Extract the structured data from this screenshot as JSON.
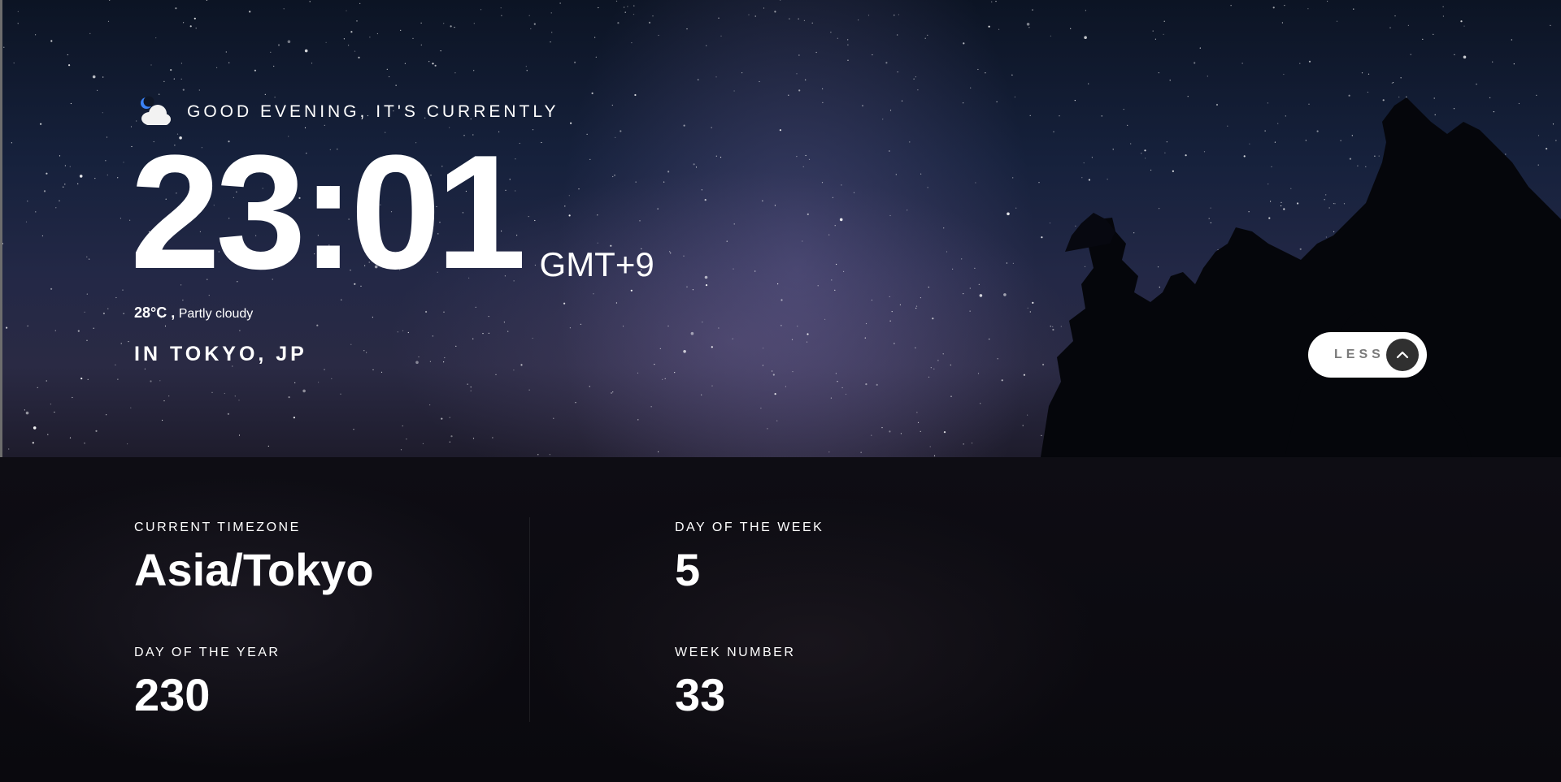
{
  "hero": {
    "greeting": "GOOD EVENING, IT'S CURRENTLY",
    "weather_icon": "moon-cloud-icon",
    "time": "23:01",
    "timezone_abbr": "GMT+9",
    "temperature": "28°C ,",
    "condition": "Partly cloudy",
    "location": "IN TOKYO, JP"
  },
  "toggle": {
    "label": "LESS",
    "icon": "chevron-up-icon"
  },
  "details": {
    "current_timezone": {
      "label": "CURRENT TIMEZONE",
      "value": "Asia/Tokyo"
    },
    "day_of_week": {
      "label": "DAY OF THE WEEK",
      "value": "5"
    },
    "day_of_year": {
      "label": "DAY OF THE YEAR",
      "value": "230"
    },
    "week_number": {
      "label": "WEEK NUMBER",
      "value": "33"
    }
  },
  "colors": {
    "button_bg": "#ffffff",
    "button_icon_bg": "#303030",
    "button_label": "#7a7a7a",
    "panel_bg": "#0c0b10"
  }
}
